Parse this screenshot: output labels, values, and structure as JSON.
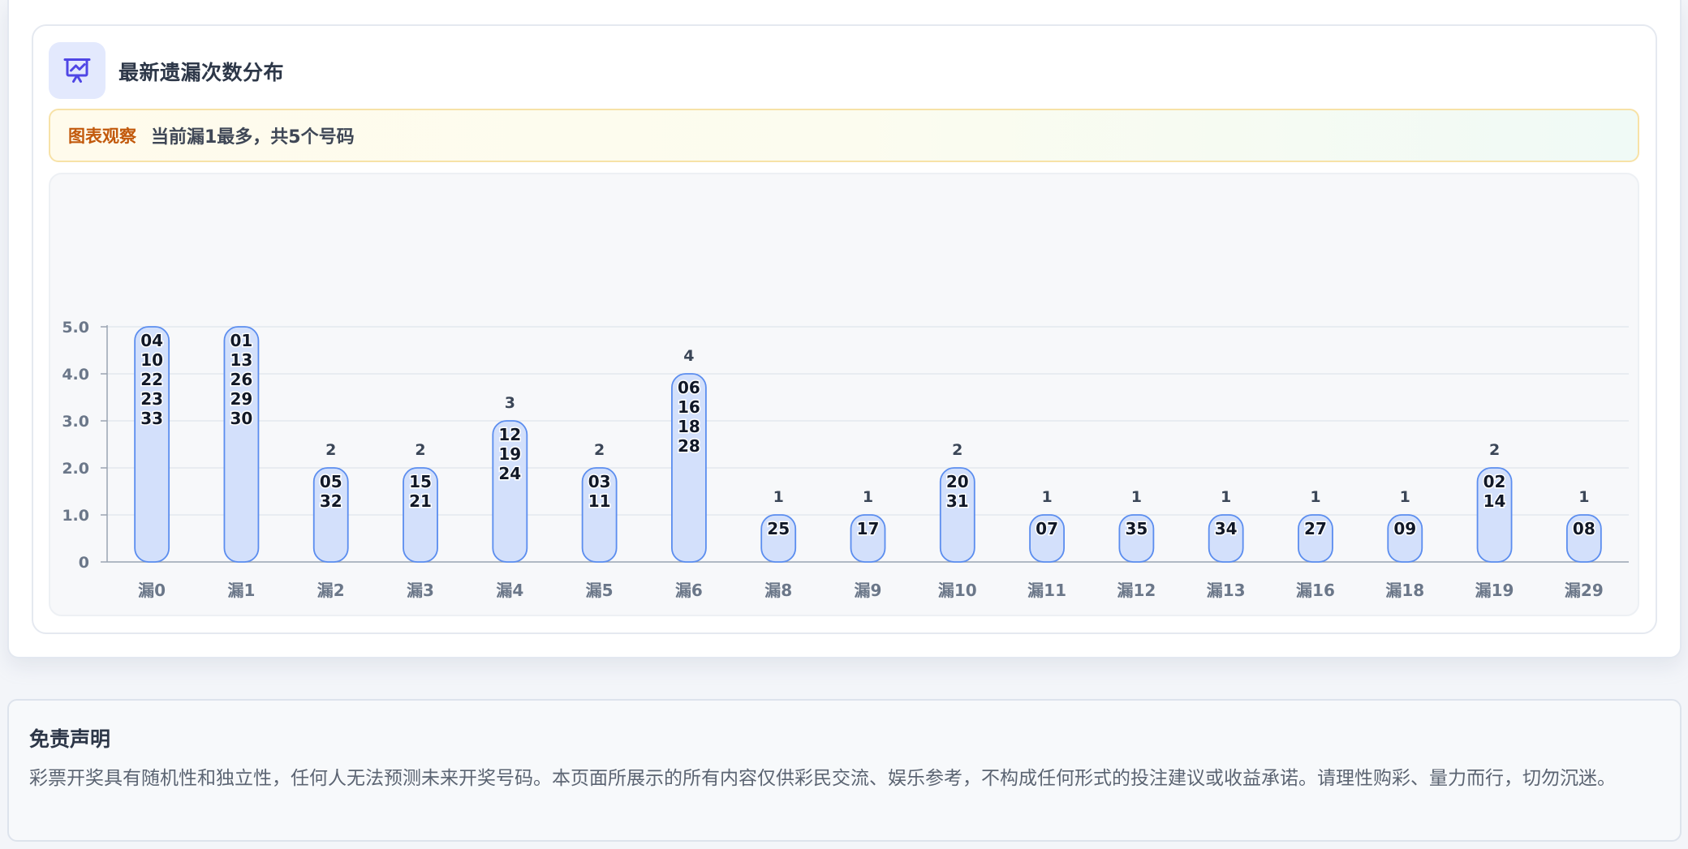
{
  "header": {
    "title": "最新遗漏次数分布",
    "icon": "presentation-chart-icon",
    "icon_color": "#4f46e5"
  },
  "observation": {
    "label": "图表观察",
    "text": "当前漏1最多，共5个号码"
  },
  "chart_data": {
    "type": "bar",
    "categories": [
      "漏0",
      "漏1",
      "漏2",
      "漏3",
      "漏4",
      "漏5",
      "漏6",
      "漏8",
      "漏9",
      "漏10",
      "漏11",
      "漏12",
      "漏13",
      "漏16",
      "漏18",
      "漏19",
      "漏29"
    ],
    "values": [
      5,
      5,
      2,
      2,
      3,
      2,
      4,
      1,
      1,
      2,
      1,
      1,
      1,
      1,
      1,
      2,
      1
    ],
    "bar_numbers": [
      [
        "04",
        "10",
        "22",
        "23",
        "33"
      ],
      [
        "01",
        "13",
        "26",
        "29",
        "30"
      ],
      [
        "05",
        "32"
      ],
      [
        "15",
        "21"
      ],
      [
        "12",
        "19",
        "24"
      ],
      [
        "03",
        "11"
      ],
      [
        "06",
        "16",
        "18",
        "28"
      ],
      [
        "25"
      ],
      [
        "17"
      ],
      [
        "20",
        "31"
      ],
      [
        "07"
      ],
      [
        "35"
      ],
      [
        "34"
      ],
      [
        "27"
      ],
      [
        "09"
      ],
      [
        "02",
        "14"
      ],
      [
        "08"
      ]
    ],
    "y_ticks": [
      "0",
      "1.0",
      "2.0",
      "3.0",
      "4.0",
      "5.0"
    ],
    "ylim": [
      0,
      5
    ],
    "grid": true,
    "bar_color": "#d3e0fb",
    "bar_border_color": "#5b8def"
  },
  "disclaimer": {
    "title": "免责声明",
    "text": "彩票开奖具有随机性和独立性，任何人无法预测未来开奖号码。本页面所展示的所有内容仅供彩民交流、娱乐参考，不构成任何形式的投注建议或收益承诺。请理性购彩、量力而行，切勿沉迷。"
  }
}
